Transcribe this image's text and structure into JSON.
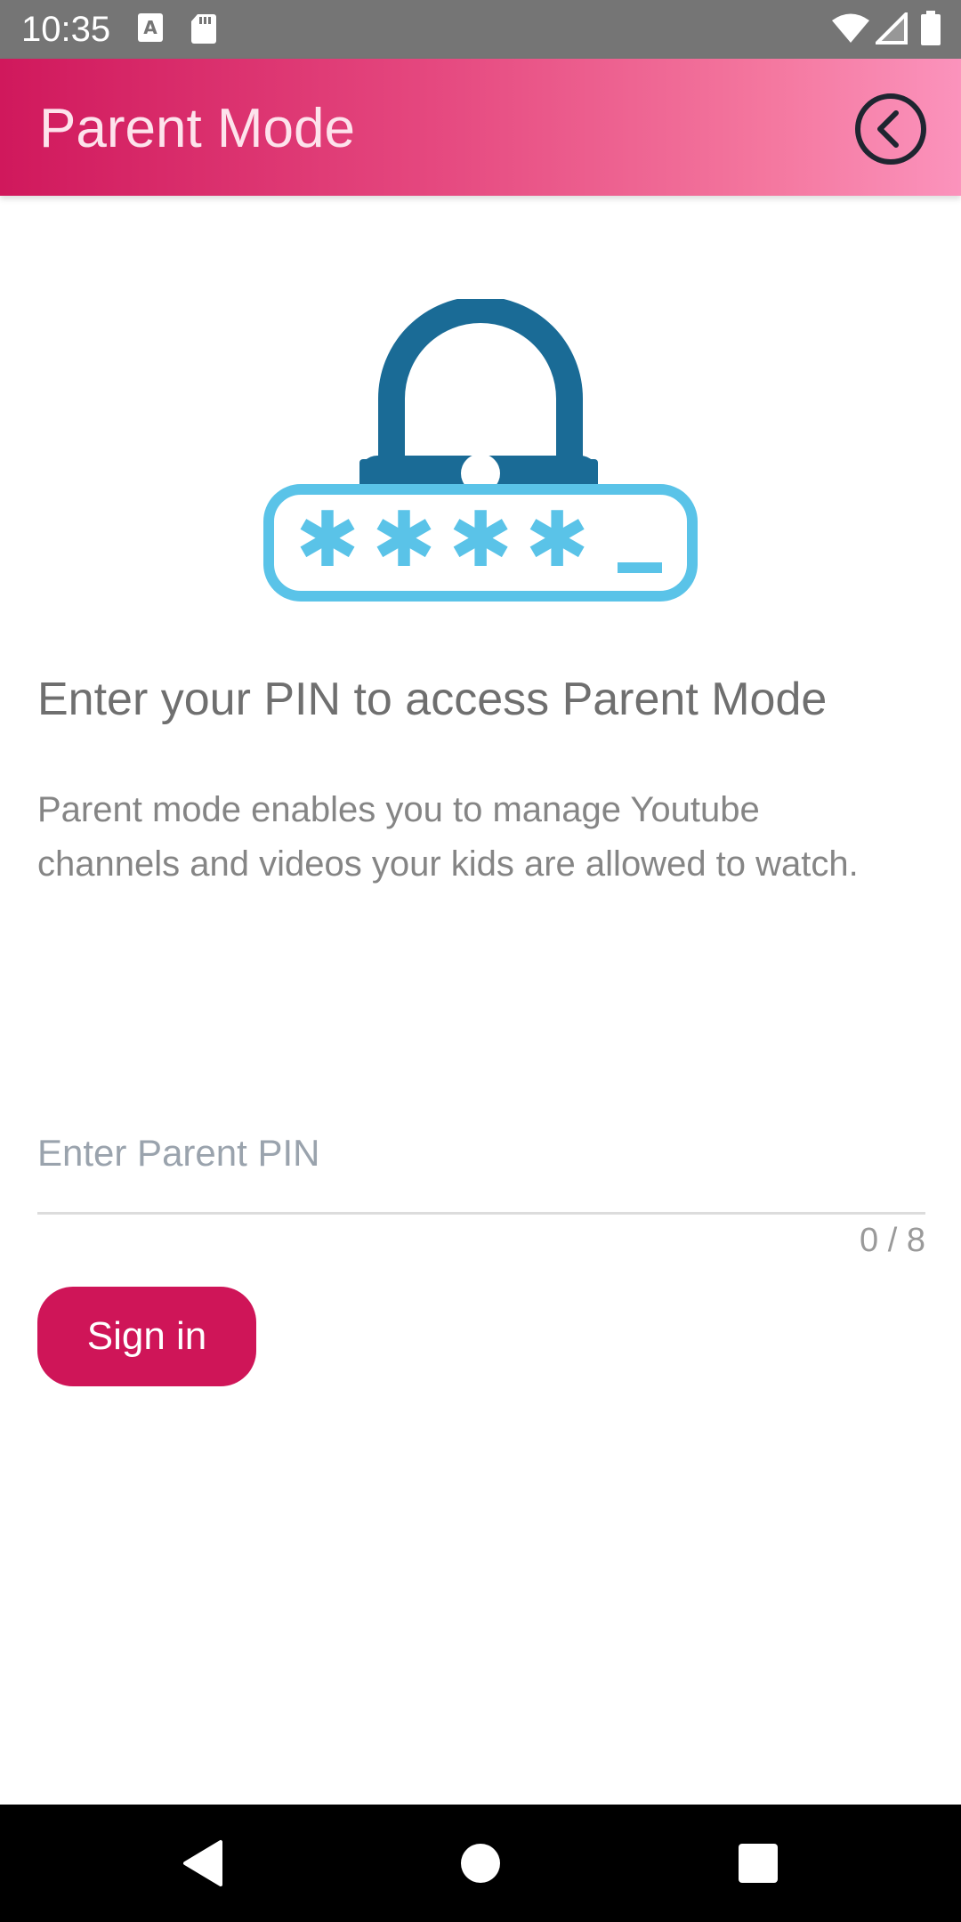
{
  "status_bar": {
    "time": "10:35",
    "icons": [
      "text-a-icon",
      "sd-card-icon",
      "wifi-icon",
      "cell-signal-icon",
      "battery-icon"
    ]
  },
  "app_bar": {
    "title": "Parent Mode",
    "back_icon": "chevron-left-circle-icon",
    "gradient_colors": [
      "#d0185c",
      "#fb93bc"
    ]
  },
  "illustration": {
    "icon": "lock-password-icon",
    "mask_text": "✱✱✱✱",
    "lock_color": "#1a6b96",
    "field_color": "#5ac3e8"
  },
  "main": {
    "heading": "Enter your PIN to access Parent Mode",
    "description": "Parent mode enables you to manage Youtube channels and videos your kids are allowed to watch."
  },
  "pin_field": {
    "placeholder": "Enter Parent PIN",
    "value": "",
    "counter": "0 / 8"
  },
  "signin": {
    "label": "Sign in",
    "color": "#cf1558"
  },
  "nav_bar": {
    "icons": [
      "back-triangle-icon",
      "home-circle-icon",
      "recents-square-icon"
    ]
  }
}
